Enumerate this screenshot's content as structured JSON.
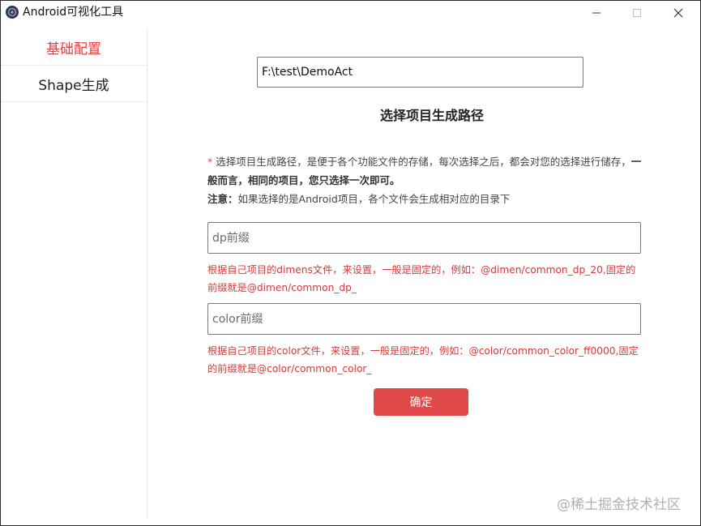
{
  "window": {
    "title": "Android可视化工具",
    "icons": {
      "app": "app-logo-icon",
      "minimize": "minimize-icon",
      "maximize": "maximize-icon",
      "close": "close-icon"
    }
  },
  "sidebar": {
    "items": [
      {
        "label": "基础配置",
        "active": true
      },
      {
        "label": "Shape生成",
        "active": false
      }
    ],
    "accent": "#e04040"
  },
  "main": {
    "path_value": "F:\\test\\DemoAct",
    "section_title": "选择项目生成路径",
    "desc": {
      "star": "*",
      "line1_a": " 选择项目生成路径，是便于各个功能文件的存储，每次选择之后，都会对您的选择进行储存，",
      "line1_b": "一般而言，相同的项目，您只选择一次即可。",
      "note_label": "注意：",
      "note_text": "如果选择的是Android项目，各个文件会生成相对应的目录下"
    },
    "dp_field": {
      "placeholder": "dp前缀",
      "value": ""
    },
    "dp_hint": "根据自己项目的dimens文件，来设置，一般是固定的，例如：@dimen/common_dp_20,固定的前缀就是@dimen/common_dp_",
    "color_field": {
      "placeholder": "color前缀",
      "value": ""
    },
    "color_hint": "根据自己项目的color文件，来设置，一般是固定的，例如：@color/common_color_ff0000,固定的前缀就是@color/common_color_",
    "confirm_label": "确定",
    "button_color": "#e04a4a",
    "hint_color": "#d23a3a"
  },
  "watermark": "@稀土掘金技术社区"
}
